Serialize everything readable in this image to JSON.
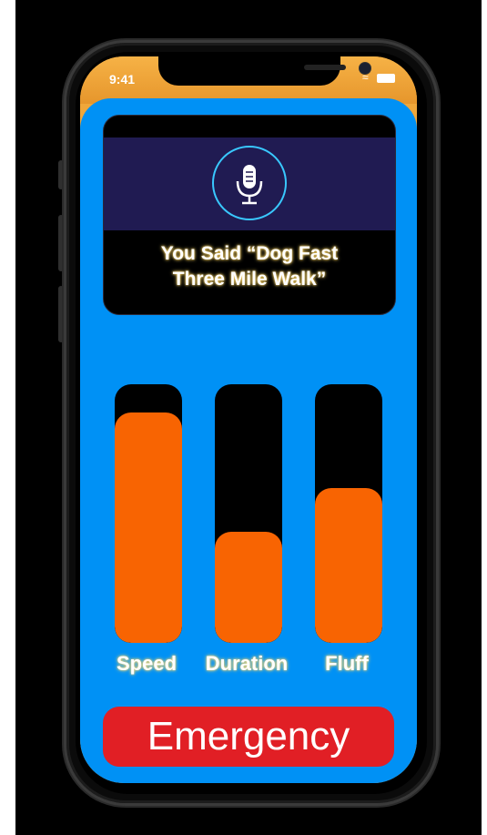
{
  "status_bar": {
    "time": "9:41",
    "wifi_icon": "wifi-icon",
    "battery_icon": "battery-icon"
  },
  "voice": {
    "mic_icon": "microphone-icon",
    "transcript_line1": "You Said “Dog Fast",
    "transcript_line2": "Three Mile Walk”"
  },
  "meters": [
    {
      "label": "Speed",
      "level": 0.89
    },
    {
      "label": "Duration",
      "level": 0.43
    },
    {
      "label": "Fluff",
      "level": 0.6
    }
  ],
  "emergency_button": {
    "label": "Emergency"
  },
  "colors": {
    "app_background": "#0091f5",
    "status_bar": "#f0a73a",
    "meter_fill": "#f86402",
    "meter_track": "#000000",
    "emergency": "#e11f25",
    "label_glow": "#ffd86a"
  }
}
